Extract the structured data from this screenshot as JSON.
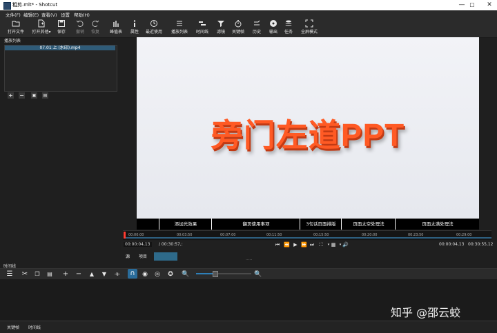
{
  "window": {
    "title": "粗剪.mlt* - Shotcut",
    "minimize": "—",
    "maximize": "☐",
    "close": "✕"
  },
  "menu": [
    "文件(F)",
    "编辑(E)",
    "查看(V)",
    "设置",
    "帮助(H)"
  ],
  "toolbar": [
    {
      "label": "打开文件",
      "icon": "folder-icon"
    },
    {
      "label": "打开其他▾",
      "icon": "open-other-icon"
    },
    {
      "label": "保存",
      "icon": "save-icon"
    },
    {
      "label": "撤销",
      "icon": "undo-icon"
    },
    {
      "label": "恢复",
      "icon": "redo-icon"
    },
    {
      "label": "峰值表",
      "icon": "peak-meter-icon"
    },
    {
      "label": "属性",
      "icon": "info-icon"
    },
    {
      "label": "最近使用",
      "icon": "clock-icon"
    },
    {
      "label": "播放列表",
      "icon": "list-icon"
    },
    {
      "label": "时间线",
      "icon": "timeline-icon"
    },
    {
      "label": "滤镜",
      "icon": "filter-icon"
    },
    {
      "label": "关键帧",
      "icon": "stopwatch-icon"
    },
    {
      "label": "历史",
      "icon": "history-icon"
    },
    {
      "label": "输出",
      "icon": "disc-icon"
    },
    {
      "label": "任务",
      "icon": "stack-icon"
    },
    {
      "label": "全屏模式",
      "icon": "fullscreen-icon"
    }
  ],
  "playlist": {
    "title": "播放列表",
    "item": "07.01 上 (水印).mp4"
  },
  "player": {
    "brand": "旁门左道PPT",
    "chapters": [
      "添加光效果",
      "翻页使用事项",
      "3句话页面排版",
      "页面太空处理法",
      "页面太满处理法"
    ]
  },
  "ruler": {
    "ticks": [
      "00:00:00",
      "00:03:50",
      "00:07:00",
      "00:11:50",
      "00:15:50",
      "00:20:00",
      "00:23:50",
      "00:29:00"
    ]
  },
  "transport": {
    "position": "00:00:04,13",
    "duration": "/ 00:30:57,:",
    "in_point": "00:00:04,13",
    "out_point": "00:30:55,12"
  },
  "source_tabs": [
    "源",
    "项目"
  ],
  "timeline": {
    "label": "时间线"
  },
  "bottom_tabs": [
    "关键帧",
    "时间线"
  ],
  "watermark": "知乎 @邵云蛟"
}
